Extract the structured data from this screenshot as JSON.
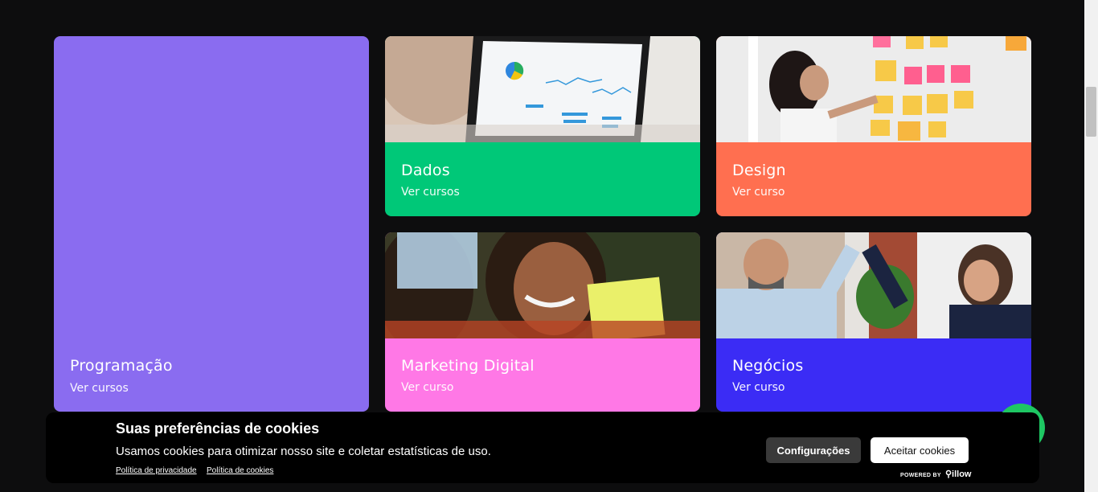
{
  "cards": [
    {
      "title": "Programação",
      "link": "Ver cursos",
      "color": "#8a6cf0"
    },
    {
      "title": "Dados",
      "link": "Ver cursos",
      "color": "#00c878"
    },
    {
      "title": "Design",
      "link": "Ver curso",
      "color": "#ff6f50"
    },
    {
      "title": "Marketing Digital",
      "link": "Ver curso",
      "color": "#ff78e6"
    },
    {
      "title": "Negócios",
      "link": "Ver curso",
      "color": "#3b2cf5"
    }
  ],
  "cookie_banner": {
    "title": "Suas preferências de cookies",
    "text": "Usamos cookies para otimizar nosso site e coletar estatísticas de uso.",
    "privacy_link": "Política de privacidade",
    "cookies_link": "Política de cookies",
    "config_button": "Configurações",
    "accept_button": "Aceitar cookies",
    "powered_by": "POWERED BY",
    "brand": "illow"
  }
}
